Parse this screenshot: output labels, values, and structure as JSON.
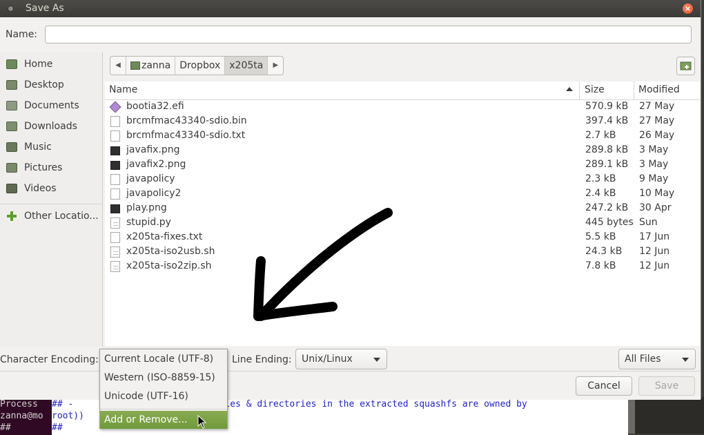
{
  "window": {
    "title": "Save As",
    "close": "×"
  },
  "name_field": {
    "label": "Name:",
    "value": ""
  },
  "sidebar": {
    "items": [
      {
        "label": "Home",
        "icon": "home-icon"
      },
      {
        "label": "Desktop",
        "icon": "desktop-icon"
      },
      {
        "label": "Documents",
        "icon": "documents-icon"
      },
      {
        "label": "Downloads",
        "icon": "downloads-icon"
      },
      {
        "label": "Music",
        "icon": "music-icon"
      },
      {
        "label": "Pictures",
        "icon": "pictures-icon"
      },
      {
        "label": "Videos",
        "icon": "videos-icon"
      },
      {
        "label": "Other Locatio...",
        "icon": "plus-icon"
      }
    ]
  },
  "pathbar": {
    "segments": [
      "zanna",
      "Dropbox",
      "x205ta"
    ]
  },
  "filelist": {
    "columns": [
      "Name",
      "Size",
      "Modified"
    ],
    "rows": [
      {
        "name": "bootia32.efi",
        "size": "570.9 kB",
        "modified": "27 May",
        "icon": "efi"
      },
      {
        "name": "brcmfmac43340-sdio.bin",
        "size": "397.4 kB",
        "modified": "27 May",
        "icon": "bin"
      },
      {
        "name": "brcmfmac43340-sdio.txt",
        "size": "2.7 kB",
        "modified": "26 May",
        "icon": "doc"
      },
      {
        "name": "javafix.png",
        "size": "289.8 kB",
        "modified": "3 May",
        "icon": "img"
      },
      {
        "name": "javafix2.png",
        "size": "289.1 kB",
        "modified": "3 May",
        "icon": "img"
      },
      {
        "name": "javapolicy",
        "size": "2.3 kB",
        "modified": "9 May",
        "icon": "doc"
      },
      {
        "name": "javapolicy2",
        "size": "2.4 kB",
        "modified": "10 May",
        "icon": "doc"
      },
      {
        "name": "play.png",
        "size": "247.2 kB",
        "modified": "30 Apr",
        "icon": "img"
      },
      {
        "name": "stupid.py",
        "size": "445 bytes",
        "modified": "Sun",
        "icon": "txt"
      },
      {
        "name": "x205ta-fixes.txt",
        "size": "5.5 kB",
        "modified": "17 Jun",
        "icon": "doc"
      },
      {
        "name": "x205ta-iso2usb.sh",
        "size": "24.3 kB",
        "modified": "12 Jun",
        "icon": "txt"
      },
      {
        "name": "x205ta-iso2zip.sh",
        "size": "7.8 kB",
        "modified": "12 Jun",
        "icon": "txt"
      }
    ]
  },
  "encoding": {
    "label": "Character Encoding:",
    "menu": [
      "Current Locale (UTF-8)",
      "Western (ISO-8859-15)",
      "Unicode (UTF-16)"
    ],
    "add_remove": "Add or Remove..."
  },
  "line_ending": {
    "label": "Line Ending:",
    "value": "Unix/Linux"
  },
  "filter": {
    "value": "All Files"
  },
  "buttons": {
    "cancel": "Cancel",
    "save": "Save"
  },
  "background": {
    "terminal_lines": [
      "Process",
      "zanna@mo",
      "##"
    ],
    "editor_lines": [
      "## -                        e files & directories in the extracted squashfs are owned by",
      "root))",
      "##"
    ]
  },
  "colors": {
    "highlight": "#7aa346",
    "titlebar": "#3c3b37",
    "close": "#e95420"
  }
}
